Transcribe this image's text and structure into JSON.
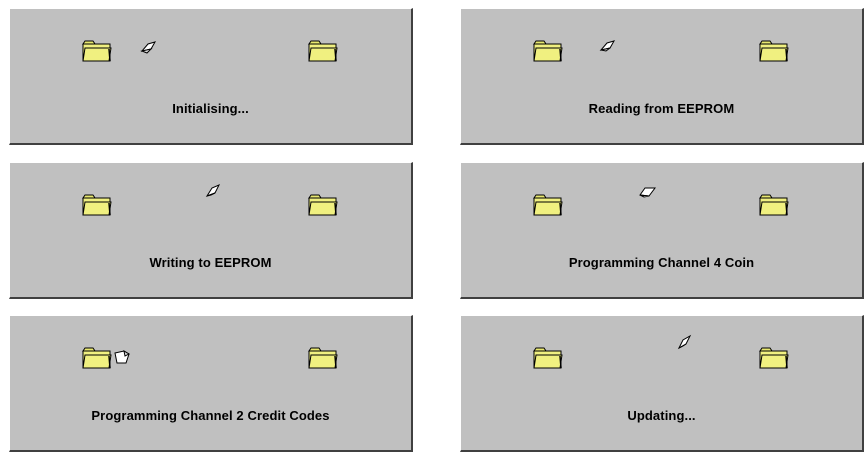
{
  "panels": [
    {
      "id": "initialising",
      "status": "Initialising..."
    },
    {
      "id": "reading",
      "status": "Reading from EEPROM"
    },
    {
      "id": "writing",
      "status": "Writing to EEPROM"
    },
    {
      "id": "programming-coin",
      "status": "Programming Channel 4 Coin"
    },
    {
      "id": "programming-credit",
      "status": "Programming Channel 2 Credit Codes"
    },
    {
      "id": "updating",
      "status": "Updating..."
    }
  ],
  "icons": {
    "source": "folder-icon",
    "destination": "folder-icon",
    "transfer": "paper-icon"
  },
  "colors": {
    "panel_background": "#c0c0c0",
    "folder_fill": "#f0f080",
    "folder_outline": "#000000",
    "paper_fill": "#ffffff"
  }
}
